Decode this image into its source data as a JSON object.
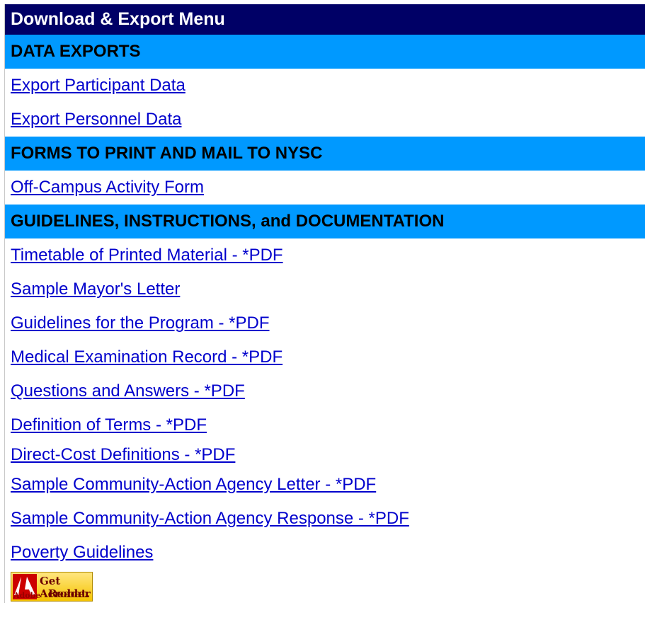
{
  "menu": {
    "title": "Download & Export Menu",
    "sections": [
      {
        "heading": "DATA EXPORTS",
        "links": [
          "Export Participant Data",
          "Export Personnel Data"
        ]
      },
      {
        "heading": "FORMS TO PRINT AND MAIL TO NYSC",
        "links": [
          "Off-Campus Activity Form"
        ]
      },
      {
        "heading": "GUIDELINES, INSTRUCTIONS, and DOCUMENTATION",
        "links": [
          "Timetable of Printed Material - *PDF",
          "Sample Mayor's Letter",
          "Guidelines for the Program - *PDF",
          "Medical Examination Record - *PDF",
          "Questions and Answers - *PDF",
          "Definition of Terms - *PDF",
          "Direct-Cost Definitions - *PDF",
          "Sample Community-Action Agency Letter - *PDF",
          "Sample Community-Action Agency Response - *PDF",
          "Poverty Guidelines"
        ]
      }
    ]
  },
  "acrobat_badge": {
    "line1": "Get Acrobat.",
    "line2": "Reader",
    "brand": "Adobe",
    "icon": "adobe-logo-icon"
  },
  "colors": {
    "header_bg": "#000066",
    "section_bg": "#0099ff",
    "link": "#0000cc"
  }
}
